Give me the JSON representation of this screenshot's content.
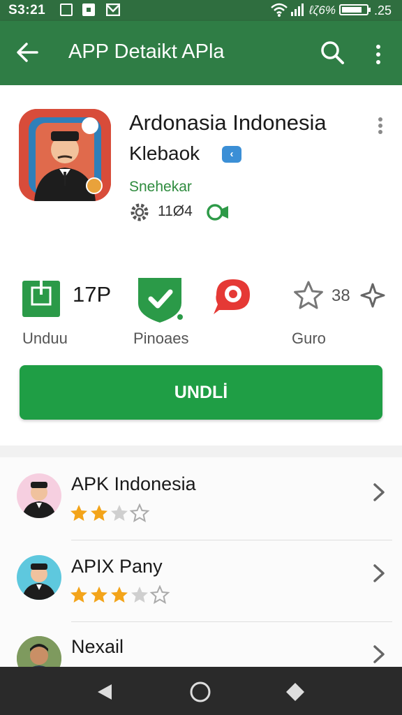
{
  "status_bar": {
    "time": "S3:21",
    "battery_pct": "ℓζ6%",
    "battery_level": ".25"
  },
  "app_bar": {
    "title": "APP Detaikt APla"
  },
  "app": {
    "name": "Ardonasia Indonesia",
    "developer": "Klebaok",
    "verified_badge": "‹",
    "category": "Snehekar",
    "rating_count": "11Ø4"
  },
  "stats": {
    "downloads_value": "17P",
    "downloads_label": "Unduu",
    "protect_label": "Pinoaes",
    "rating_value": "38",
    "rating_label": "Guro"
  },
  "install_button": "UNDLİ",
  "list": [
    {
      "title": "APK Indonesia",
      "stars": 2
    },
    {
      "title": "APIX Pany",
      "stars": 3
    },
    {
      "title": "Nexail"
    }
  ],
  "colors": {
    "status_bar": "#2f6e3f",
    "app_bar": "#2f7d45",
    "install_button": "#1f9e45",
    "star": "#f3a41a",
    "category_text": "#2e8b3e"
  },
  "icons": [
    "back-arrow-icon",
    "search-icon",
    "overflow-menu-icon",
    "wifi-icon",
    "signal-icon",
    "battery-icon",
    "download-icon",
    "shield-check-icon",
    "location-pin-icon",
    "star-icon",
    "chevron-right-icon",
    "nav-back-icon",
    "nav-home-icon",
    "nav-recents-icon"
  ]
}
